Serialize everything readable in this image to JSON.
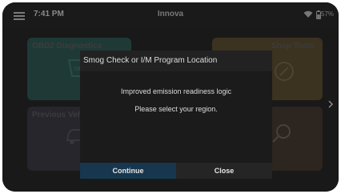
{
  "status_bar": {
    "time": "7:41 PM",
    "app_title": "Innova",
    "battery": "57%"
  },
  "tiles": [
    {
      "label": "OBD2 Diagnostics",
      "icon": "obd-connector-icon",
      "color": "#1f3a36"
    },
    {
      "label": "Shop Tools",
      "icon": "tools-icon",
      "color": "#3b3220"
    },
    {
      "label": "Previous Vehicles",
      "icon": "vehicle-icon",
      "color": "#26262c"
    },
    {
      "label": "",
      "icon": "search-help-icon",
      "color": "#2c2520"
    }
  ],
  "dialog": {
    "title": "Smog Check or I/M Program Location",
    "message_line1": "Improved emission readiness logic",
    "message_line2": "Please select your region.",
    "continue_label": "Continue",
    "close_label": "Close"
  },
  "colors": {
    "continue_button": "#16374f",
    "background": "#141414"
  }
}
